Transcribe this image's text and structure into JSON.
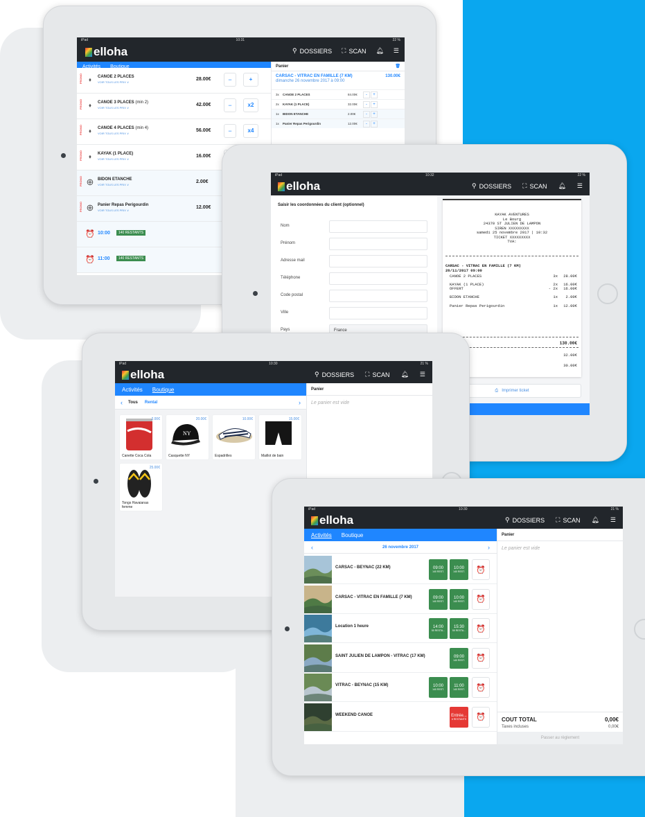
{
  "colors": {
    "accent": "#1f86ff",
    "topbar": "#22262b",
    "green": "#3b8d4f",
    "red": "#e53935",
    "background_blue": "#0aa7ef"
  },
  "common": {
    "brand": "elloha",
    "nav_dossiers": "DOSSIERS",
    "nav_scan": "SCAN",
    "tab_activites": "Activités",
    "tab_boutique": "Boutique",
    "panier": "Panier",
    "icons": [
      "search-icon",
      "scan-icon",
      "bell-icon",
      "menu-icon",
      "alarm-clock-icon",
      "tag-icon",
      "plus-circle-icon",
      "trash-icon",
      "printer-icon"
    ]
  },
  "screen1": {
    "status_left": "iPad",
    "time": "10:31",
    "status_right": "22 %",
    "voir": "VOIR TOUS LES PRIX",
    "promo": "PROMO",
    "products": [
      {
        "name": "CANOE 2 PLACES",
        "suffix": "",
        "price": "28.00€",
        "mult": "+"
      },
      {
        "name": "CANOE 3 PLACES",
        "suffix": " (min 2)",
        "price": "42.00€",
        "mult": "x2"
      },
      {
        "name": "CANOE 4 PLACES",
        "suffix": " (min 4)",
        "price": "56.00€",
        "mult": "x4"
      },
      {
        "name": "KAYAK (1 PLACE)",
        "suffix": "",
        "price": "16.00€",
        "mult": ""
      },
      {
        "name": "BIDON ETANCHE",
        "suffix": "",
        "price": "2.00€",
        "mult": ""
      },
      {
        "name": "Panier Repas Perigourdin",
        "suffix": "",
        "price": "12.00€",
        "mult": ""
      }
    ],
    "times": [
      {
        "time": "10:00",
        "badge": "140 RESTANTS"
      },
      {
        "time": "11:00",
        "badge": "140 RESTANTS"
      }
    ],
    "cart_title": "CARSAC - VITRAC EN FAMILLE (7 KM)",
    "cart_price": "130.00€",
    "cart_date": "dimanche 26 novembre 2017 à 09:00",
    "cart_lines": [
      {
        "qty": "3x",
        "name": "CANOE 2 PLACES",
        "price": "84.00€"
      },
      {
        "qty": "2x",
        "name": "KAYAK (1 PLACE)",
        "price": "32.00€"
      },
      {
        "qty": "1x",
        "name": "BIDON ETANCHE",
        "price": "2.00€"
      },
      {
        "qty": "1x",
        "name": "Panier Repas Perigourdin",
        "price": "12.00€"
      }
    ]
  },
  "screen2": {
    "status_left": "iPad",
    "time": "10:32",
    "status_right": "22 %",
    "form_title": "Saisir les coordonnées du client (optionnel)",
    "fields": [
      "Nom",
      "Prénom",
      "Adresse mail",
      "Téléphone",
      "Code postal",
      "Ville",
      "Pays"
    ],
    "country": "France",
    "receipt_header": [
      "KAYAK AVENTURES",
      "Le Bourg",
      "24370 ST JULIEN DE LAMPON",
      "SIREN XXXXXXXXX",
      "samedi 25 novembre 2017 | 10:32",
      "TICKET XXXXXXXXX",
      "TVA:"
    ],
    "receipt_activity": "CARSAC - VITRAC EN FAMILLE (7 KM)",
    "receipt_date": "26/11/2017 09:00",
    "receipt_lines": [
      {
        "name": "CANOE 2 PLACES",
        "qty": "3x",
        "price": "28.00€"
      },
      {
        "name": "KAYAK (1 PLACE)",
        "qty": "2x",
        "price": "16.00€"
      },
      {
        "name": "OFFERT",
        "qty": "- 2x",
        "price": "16.00€"
      },
      {
        "name": "BIDON ETANCHE",
        "qty": "1x",
        "price": "2.00€"
      },
      {
        "name": "Panier Repas Perigourdin",
        "qty": "1x",
        "price": "12.00€"
      }
    ],
    "receipt_total": "130.00€",
    "receipt_e": "e",
    "receipt_extra": [
      "32.00€",
      "30.00€"
    ],
    "print_button": "Imprimer ticket"
  },
  "screen3": {
    "status_left": "iPad",
    "time": "10:30",
    "status_right": "21 %",
    "filter_all": "Tous",
    "filter_rental": "Rental",
    "empty_cart": "Le panier est vide",
    "products": [
      {
        "name": "Canette Coca Cola",
        "price": "2.00€"
      },
      {
        "name": "Casquette NY",
        "price": "20.00€"
      },
      {
        "name": "Espadrilles",
        "price": "10.00€"
      },
      {
        "name": "Maillot de bain",
        "price": "15.00€"
      },
      {
        "name": "Tongs Havaianas femme",
        "price": "25.00€"
      }
    ]
  },
  "screen4": {
    "status_left": "iPad",
    "time": "10:30",
    "status_right": "21 %",
    "date": "26 novembre 2017",
    "empty_cart": "Le panier est vide",
    "total_label": "COUT TOTAL",
    "total_value": "0,00€",
    "taxes_label": "Taxes incluses",
    "taxes_value": "0,00€",
    "pay_button": "Passer au règlement",
    "activities": [
      {
        "name": "CARSAC - BEYNAC (22 KM)",
        "slots": [
          {
            "t": "09:00",
            "r": "140 REST."
          },
          {
            "t": "10:00",
            "r": "140 REST."
          }
        ]
      },
      {
        "name": "CARSAC - VITRAC EN FAMILLE (7 KM)",
        "slots": [
          {
            "t": "09:00",
            "r": "140 REST."
          },
          {
            "t": "10:00",
            "r": "140 REST."
          }
        ]
      },
      {
        "name": "Location 1 heure",
        "slots": [
          {
            "t": "14:00",
            "r": "50 RESTA..."
          },
          {
            "t": "15:30",
            "r": "50 RESTA..."
          }
        ]
      },
      {
        "name": "SAINT JULIEN DE LAMPON - VITRAC (17 KM)",
        "slots": [
          {
            "t": "09:00",
            "r": "140 REST."
          }
        ]
      },
      {
        "name": "VITRAC - BEYNAC (15 KM)",
        "slots": [
          {
            "t": "10:00",
            "r": "140 REST."
          },
          {
            "t": "11:00",
            "r": "140 REST."
          }
        ]
      },
      {
        "name": "WEEKEND CANOE",
        "slots": [
          {
            "t": "Entrée...",
            "r": "6 RESTANTS",
            "red": true
          }
        ]
      }
    ]
  }
}
